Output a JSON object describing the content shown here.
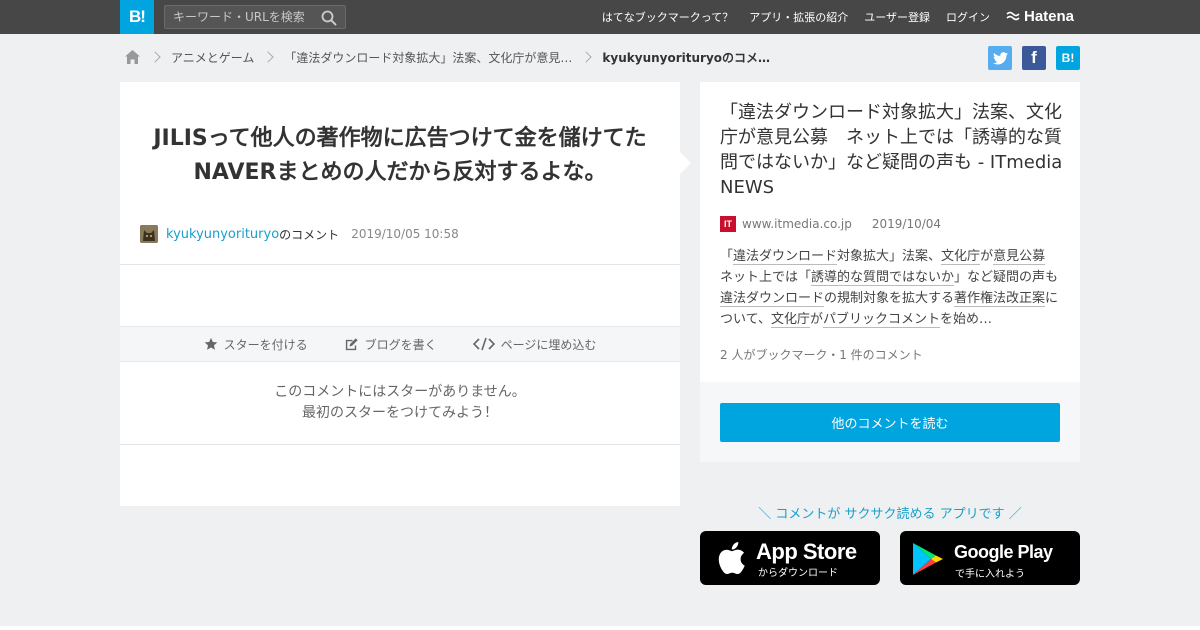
{
  "header": {
    "logo": "B!",
    "search_placeholder": "キーワード・URLを検索",
    "nav": [
      "はてなブックマークって？",
      "アプリ・拡張の紹介",
      "ユーザー登録",
      "ログイン"
    ],
    "brand": "Hatena"
  },
  "breadcrumb": {
    "items": [
      "アニメとゲーム",
      "「違法ダウンロード対象拡大」法案、文化庁が意見…",
      "kyukyunyorituryoのコメ…"
    ]
  },
  "share": {
    "twitter": "twitter-icon",
    "facebook": "f",
    "hatena": "B!"
  },
  "comment": {
    "text": "JILISって他人の著作物に広告つけて金を儲けてたNAVERまとめの人だから反対するよな。",
    "user": "kyukyunyorituryo",
    "suffix": "のコメント",
    "date": "2019/10/05 10:58"
  },
  "actions": {
    "star": "スターを付ける",
    "blog": "ブログを書く",
    "embed": "ページに埋め込む"
  },
  "no_star": {
    "line1": "このコメントにはスターがありません。",
    "line2": "最初のスターをつけてみよう！"
  },
  "entry": {
    "title": "「違法ダウンロード対象拡大」法案、文化庁が意見公募　ネット上では「誘導的な質問ではないか」など疑問の声も - ITmedia NEWS",
    "favicon": "IT",
    "domain": "www.itmedia.co.jp",
    "date": "2019/10/04",
    "summary": {
      "s1": "「",
      "u1": "違法ダウンロード",
      "s2": "対象拡大」法案、",
      "u2": "文化庁",
      "s3": "が",
      "u3": "意見公募",
      "s4": "ネット上では「",
      "u4": "誘導的な質問ではないか",
      "s5": "」など疑問の声も",
      "u5": "違法ダウンロード",
      "s6": "の規制対象を拡大する",
      "u6": "著作権法改正案",
      "s7": "について、",
      "u7": "文化庁",
      "s8": "が",
      "u8": "パブリックコメント",
      "s9": "を始め…"
    },
    "bookmarks": "2 人がブックマーク・1 件のコメント",
    "read_button": "他のコメントを読む"
  },
  "promo": {
    "tagline": "＼ コメントが サクサク読める アプリです ／",
    "apple_main": "App Store",
    "apple_sub": "からダウンロード",
    "google_main": "Google Play",
    "google_sub": "で手に入れよう"
  },
  "colors": {
    "topbar": "#474747",
    "accent": "#00a4de",
    "link": "#1a9fc9",
    "twitter": "#55acee",
    "facebook": "#3b5998"
  }
}
